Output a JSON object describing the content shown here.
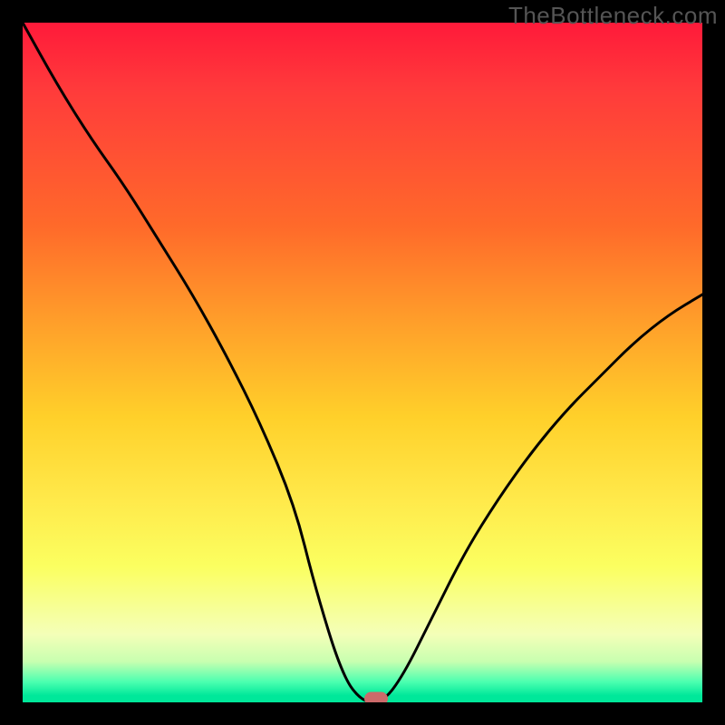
{
  "watermark": "TheBottleneck.com",
  "chart_data": {
    "type": "line",
    "title": "",
    "xlabel": "",
    "ylabel": "",
    "xlim": [
      0,
      100
    ],
    "ylim": [
      0,
      100
    ],
    "grid": false,
    "legend": false,
    "x": [
      0,
      5,
      10,
      15,
      20,
      25,
      30,
      35,
      40,
      43,
      47,
      50,
      53,
      56,
      60,
      65,
      70,
      75,
      80,
      85,
      90,
      95,
      100
    ],
    "values": [
      100,
      91,
      83,
      76,
      68,
      60,
      51,
      41,
      29,
      17,
      4,
      0,
      0,
      4,
      12,
      22,
      30,
      37,
      43,
      48,
      53,
      57,
      60
    ],
    "marker": {
      "x": 52,
      "y": 0
    },
    "colors": {
      "curve": "#000000",
      "marker": "#cc6a6a",
      "gradient_top": "#ff1a3a",
      "gradient_bottom": "#00e89a",
      "background": "#000000"
    }
  }
}
